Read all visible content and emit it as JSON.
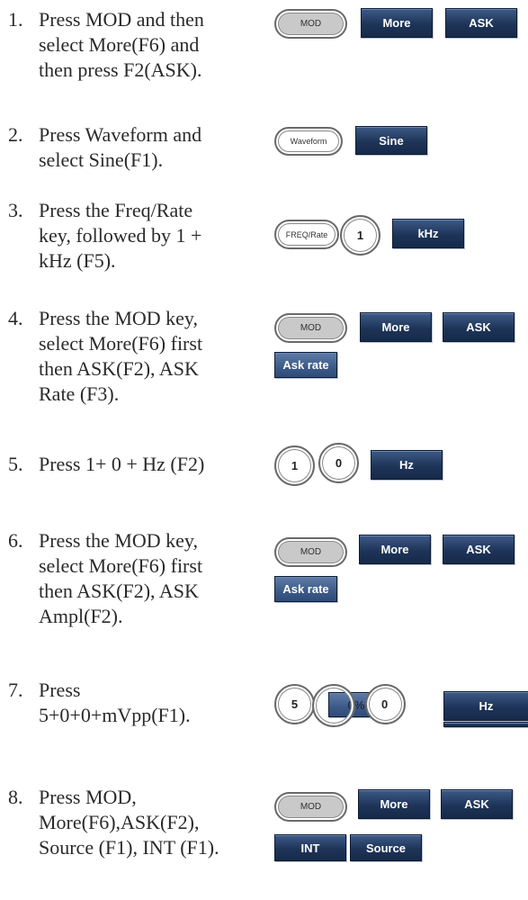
{
  "steps": [
    {
      "num": "1.",
      "lines": [
        "Press MOD and then",
        "select More(F6) and",
        "then press F2(ASK)."
      ]
    },
    {
      "num": "2.",
      "lines": [
        "Press Waveform and",
        "select Sine(F1)."
      ]
    },
    {
      "num": "3.",
      "lines": [
        "Press the Freq/Rate",
        "key, followed by 1 +",
        "kHz (F5)."
      ]
    },
    {
      "num": "4.",
      "lines": [
        "Press the MOD key,",
        "select More(F6) first",
        "then ASK(F2), ASK",
        "Rate (F3)."
      ]
    },
    {
      "num": "5.",
      "lines": [
        "Press 1+ 0 + Hz (F2)"
      ]
    },
    {
      "num": "6.",
      "lines": [
        "Press the MOD key,",
        "select More(F6) first",
        "then ASK(F2), ASK",
        "Ampl(F2)."
      ]
    },
    {
      "num": "7.",
      "lines": [
        "Press",
        "5+0+0+mVpp(F1)."
      ]
    },
    {
      "num": "8.",
      "lines": [
        "Press MOD,",
        "More(F6),ASK(F2),",
        "Source (F1), INT (F1)."
      ]
    }
  ],
  "keys": {
    "s1": {
      "mod": "MOD",
      "more": "More",
      "ask": "ASK"
    },
    "s2": {
      "waveform": "Waveform",
      "sine": "Sine"
    },
    "s3": {
      "freq": "FREQ/Rate",
      "one": "1",
      "khz": "kHz"
    },
    "s4": {
      "mod": "MOD",
      "more": "More",
      "ask": "ASK",
      "askrate": "Ask rate"
    },
    "s5": {
      "one": "1",
      "zero": "0",
      "hz": "Hz"
    },
    "s6": {
      "mod": "MOD",
      "more": "More",
      "ask": "ASK",
      "askrate": "Ask rate"
    },
    "s7": {
      "five": "5",
      "zero_pct": "0%",
      "zero": "0",
      "hz": "Hz"
    },
    "s8": {
      "mod": "MOD",
      "more": "More",
      "ask": "ASK",
      "int": "INT",
      "source": "Source"
    }
  }
}
